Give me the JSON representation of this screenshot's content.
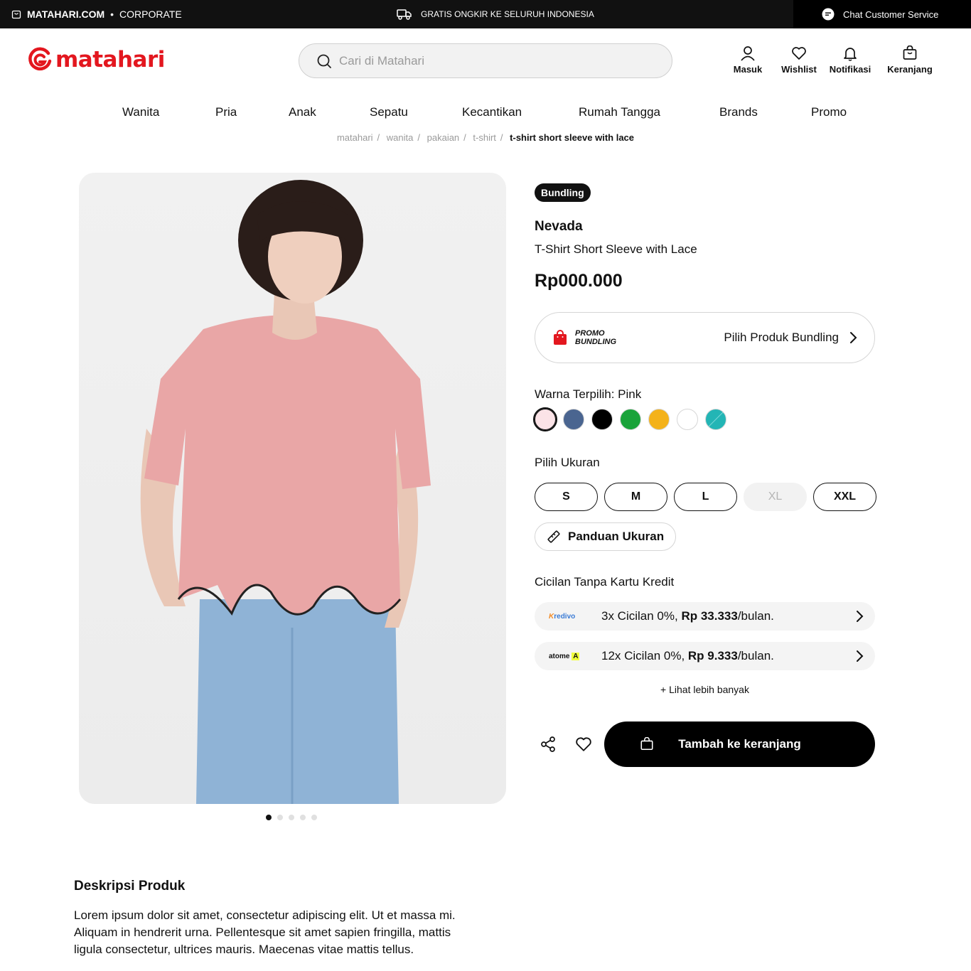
{
  "topbar": {
    "site": "MATAHARI.COM",
    "bullet": "•",
    "corporate": "CORPORATE",
    "shipping": "GRATIS ONGKIR KE SELURUH INDONESIA",
    "chat": "Chat Customer Service"
  },
  "header": {
    "logo_text": "matahari",
    "search_placeholder": "Cari di Matahari",
    "icons": [
      {
        "label": "Masuk",
        "icon": "user-icon"
      },
      {
        "label": "Wishlist",
        "icon": "heart-icon"
      },
      {
        "label": "Notifikasi",
        "icon": "bell-icon"
      },
      {
        "label": "Keranjang",
        "icon": "bag-icon"
      }
    ]
  },
  "nav": [
    "Wanita",
    "Pria",
    "Anak",
    "Sepatu",
    "Kecantikan",
    "Rumah Tangga",
    "Brands",
    "Promo"
  ],
  "breadcrumb": [
    "matahari",
    "wanita",
    "pakaian",
    "t-shirt",
    "t-shirt short sleeve with lace"
  ],
  "gallery": {
    "total": 5,
    "active": 1
  },
  "product": {
    "badge": "Bundling",
    "brand": "Nevada",
    "name": "T-Shirt Short Sleeve with Lace",
    "price": "Rp000.000"
  },
  "promo": {
    "line1": "PROMO",
    "line2": "BUNDLING",
    "link": "Pilih Produk Bundling"
  },
  "colors": {
    "label": "Warna Terpilih: Pink",
    "swatches": [
      "#fbe3e7",
      "#4a6590",
      "#000000",
      "#1aa33a",
      "#f4b21a",
      "#ffffff",
      "#23b5b5"
    ],
    "selected_index": 0
  },
  "sizes": {
    "label": "Pilih Ukuran",
    "options": [
      {
        "label": "S",
        "available": true
      },
      {
        "label": "M",
        "available": true
      },
      {
        "label": "L",
        "available": true
      },
      {
        "label": "XL",
        "available": false
      },
      {
        "label": "XXL",
        "available": true
      }
    ],
    "guide": "Panduan Ukuran"
  },
  "installments": {
    "label": "Cicilan Tanpa Kartu Kredit",
    "items": [
      {
        "provider": "Kredivo",
        "prefix": "3x Cicilan 0%, ",
        "amount": "Rp 33.333",
        "suffix": "/bulan."
      },
      {
        "provider": "atome",
        "prefix": "12x Cicilan 0%, ",
        "amount": "Rp 9.333",
        "suffix": "/bulan."
      }
    ],
    "more": "+ Lihat lebih banyak"
  },
  "cart": {
    "button": "Tambah ke keranjang"
  },
  "description": {
    "title": "Deskripsi Produk",
    "body": "Lorem ipsum dolor sit amet, consectetur adipiscing elit. Ut et massa mi. Aliquam in hendrerit urna. Pellentesque sit amet sapien fringilla, mattis ligula consectetur, ultrices mauris. Maecenas vitae mattis tellus."
  },
  "colors_theme": {
    "brand_red": "#e3171f",
    "dark": "#111111"
  }
}
